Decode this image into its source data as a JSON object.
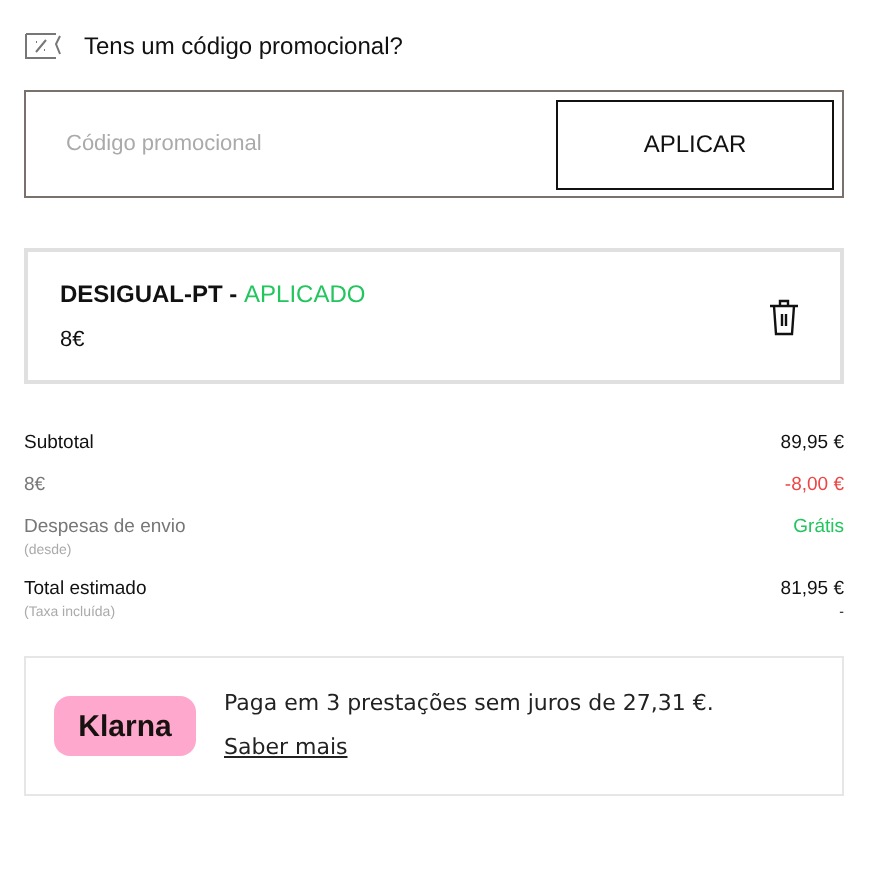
{
  "promo": {
    "question": "Tens um código promocional?",
    "placeholder": "Código promocional",
    "button": "APLICAR"
  },
  "coupon": {
    "code": "DESIGUAL-PT -",
    "status": "APLICADO",
    "amount": "8€"
  },
  "summary": [
    {
      "label": "Subtotal",
      "value": "89,95 €",
      "kind": "normal"
    },
    {
      "label": "8€",
      "value": "-8,00 €",
      "kind": "discount"
    },
    {
      "label": "Despesas de envio",
      "note": "(desde)",
      "value": "Grátis",
      "kind": "free"
    },
    {
      "label": "Total estimado",
      "note": "(Taxa incluída)",
      "value": "81,95 €",
      "value_note": "-",
      "kind": "total"
    }
  ],
  "klarna": {
    "logo": "Klarna",
    "text": "Paga em 3 prestações sem juros de 27,31 €.",
    "link": "Saber mais"
  }
}
